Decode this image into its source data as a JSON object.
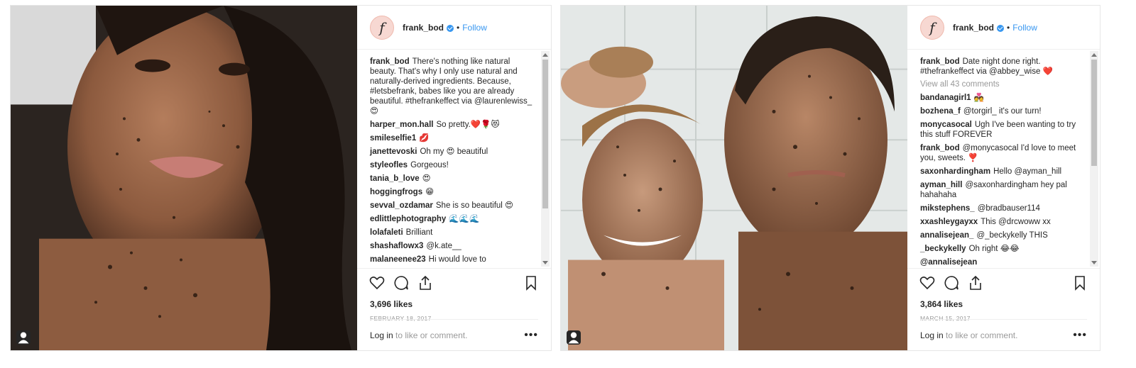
{
  "posts": [
    {
      "username": "frank_bod",
      "avatar_letter": "f",
      "dot": "•",
      "follow_label": "Follow",
      "caption": {
        "user": "frank_bod",
        "text": "There's nothing like natural beauty. That's why I only use natural and naturally-derived ingredients. Because, #letsbefrank, babes like you are already beautiful. #thefrankeffect via @laurenlewiss_ 😍"
      },
      "comments": [
        {
          "user": "harper_mon.hall",
          "text": "So pretty.❤️🌹😻"
        },
        {
          "user": "smileselfie1",
          "text": "💋"
        },
        {
          "user": "janettevoski",
          "text": "Oh my 😍 beautiful"
        },
        {
          "user": "styleofles",
          "text": "Gorgeous!"
        },
        {
          "user": "tania_b_love",
          "text": "😍"
        },
        {
          "user": "hoggingfrogs",
          "text": "😁"
        },
        {
          "user": "sevval_ozdamar",
          "text": "She is so beautiful 😍"
        },
        {
          "user": "edlittlephotography",
          "text": "🌊🌊🌊"
        },
        {
          "user": "lolafaleti",
          "text": "Brilliant"
        },
        {
          "user": "shashaflowx3",
          "text": "@k.ate__"
        },
        {
          "user": "malaneenee23",
          "text": "Hi would love to"
        }
      ],
      "likes": "3,696 likes",
      "date": "FEBRUARY 18, 2017",
      "login_link": "Log in",
      "login_rest": " to like or comment.",
      "more": "•••"
    },
    {
      "username": "frank_bod",
      "avatar_letter": "f",
      "dot": "•",
      "follow_label": "Follow",
      "caption": {
        "user": "frank_bod",
        "text": "Date night done right. #thefrankeffect via @abbey_wise ❤️"
      },
      "view_all": "View all 43 comments",
      "comments": [
        {
          "user": "bandanagirl1",
          "text": "💑"
        },
        {
          "user": "bozhena_f",
          "text": "@torgirl_ it's our turn!"
        },
        {
          "user": "monycasocal",
          "text": "Ugh I've been wanting to try this stuff FOREVER"
        },
        {
          "user": "frank_bod",
          "text": "@monycasocal I'd love to meet you, sweets. ❣️"
        },
        {
          "user": "saxonhardingham",
          "text": "Hello @ayman_hill"
        },
        {
          "user": "ayman_hill",
          "text": "@saxonhardingham hey pal hahahaha"
        },
        {
          "user": "mikstephens_",
          "text": "@bradbauser114"
        },
        {
          "user": "xxashleygayxx",
          "text": "This @drcwoww xx"
        },
        {
          "user": "annalisejean_",
          "text": "@_beckykelly THIS"
        },
        {
          "user": "_beckykelly",
          "text": "Oh right 😂😂"
        },
        {
          "user": "@annalisejean",
          "text": ""
        }
      ],
      "likes": "3,864 likes",
      "date": "MARCH 15, 2017",
      "login_link": "Log in",
      "login_rest": " to like or comment.",
      "more": "•••"
    }
  ],
  "icons": {
    "like": "heart-icon",
    "comment": "comment-bubble-icon",
    "share": "share-icon",
    "save": "bookmark-icon",
    "tagged": "person-tag-icon"
  },
  "colors": {
    "link": "#3897f0",
    "text": "#262626",
    "muted": "#999999",
    "border": "#efefef"
  }
}
